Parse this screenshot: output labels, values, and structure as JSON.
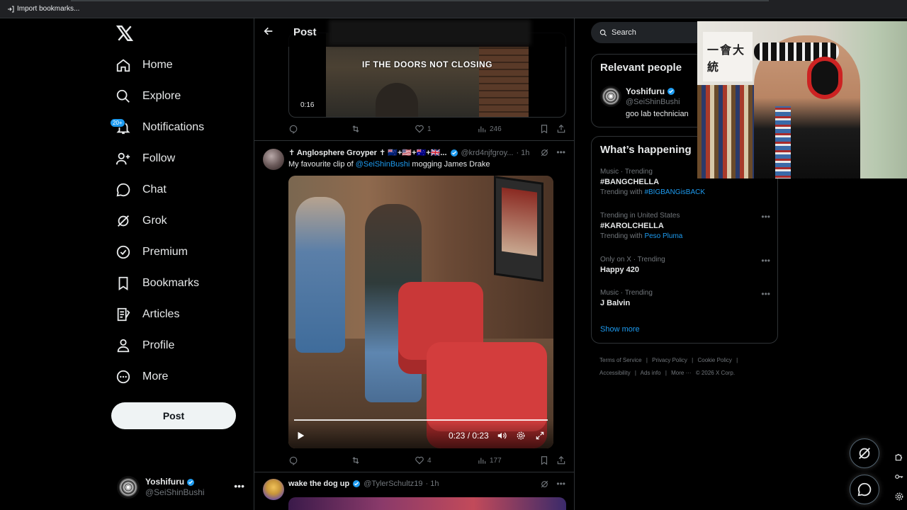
{
  "browser": {
    "import_label": "Import bookmarks..."
  },
  "nav": {
    "items": [
      {
        "label": "Home",
        "icon": "home-icon"
      },
      {
        "label": "Explore",
        "icon": "search-icon"
      },
      {
        "label": "Notifications",
        "icon": "bell-icon",
        "badge": "20+"
      },
      {
        "label": "Follow",
        "icon": "add-person-icon"
      },
      {
        "label": "Chat",
        "icon": "chat-icon"
      },
      {
        "label": "Grok",
        "icon": "grok-icon"
      },
      {
        "label": "Premium",
        "icon": "verified-icon"
      },
      {
        "label": "Bookmarks",
        "icon": "bookmark-icon"
      },
      {
        "label": "Articles",
        "icon": "article-icon"
      },
      {
        "label": "Profile",
        "icon": "person-icon"
      },
      {
        "label": "More",
        "icon": "more-circle-icon"
      }
    ],
    "post_button": "Post",
    "account": {
      "name": "Yoshifuru",
      "handle": "@SeiShinBushi"
    }
  },
  "center": {
    "header_title": "Post",
    "video1": {
      "caption": "IF THE DOORS NOT CLOSING",
      "time": "0:16"
    },
    "tweet1_actions": {
      "replies": "",
      "reposts": "",
      "likes": "1",
      "views": "246"
    },
    "tweet2": {
      "name": "✝ Anglosphere Groyper ✝ 🇳🇿+🇺🇸+🇦🇺+🇬🇧...",
      "handle": "@krd4njfgroy...",
      "time": "· 1h",
      "text_before": "My favourite clip of ",
      "mention": "@SeiShinBushi",
      "text_after": " mogging James Drake",
      "video_time": "0:23 / 0:23",
      "actions": {
        "replies": "",
        "reposts": "",
        "likes": "4",
        "views": "177"
      }
    },
    "tweet3": {
      "name": "wake the dog up",
      "handle": "@TylerSchultz19",
      "time": "· 1h"
    }
  },
  "right": {
    "search_placeholder": "Search",
    "relevant": {
      "title": "Relevant people",
      "name": "Yoshifuru",
      "handle": "@SeiShinBushi",
      "bio": "goo lab technician"
    },
    "happening": {
      "title": "What’s happening",
      "trends": [
        {
          "context": "Music · Trending",
          "topic": "#BANGCHELLA",
          "with_label": "Trending with ",
          "with_link": "#BIGBANGisBACK"
        },
        {
          "context": "Trending in United States",
          "topic": "#KAROLCHELLA",
          "with_label": "Trending with ",
          "with_link": "Peso Pluma"
        },
        {
          "context": "Only on X · Trending",
          "topic": "Happy 420",
          "with_label": "",
          "with_link": ""
        },
        {
          "context": "Music · Trending",
          "topic": "J Balvin",
          "with_label": "",
          "with_link": ""
        }
      ],
      "show_more": "Show more"
    },
    "footer": {
      "links": [
        "Terms of Service",
        "|",
        "Privacy Policy",
        "|",
        "Cookie Policy",
        "|"
      ],
      "links2": [
        "Accessibility",
        "|",
        "Ads info",
        "|",
        "More ···",
        "© 2026 X Corp."
      ]
    }
  },
  "webcam": {
    "scroll_text": "一會大統"
  }
}
